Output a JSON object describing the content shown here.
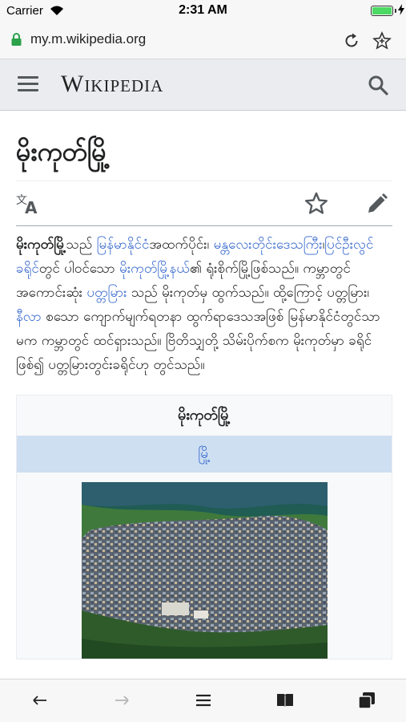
{
  "status_bar": {
    "carrier": "Carrier",
    "time": "2:31 AM",
    "battery_level": 1.0
  },
  "browser": {
    "url": "my.m.wikipedia.org"
  },
  "header": {
    "wordmark": "Wikipedia"
  },
  "page": {
    "title": "မိုးကုတ်မြို့",
    "article": {
      "lead_bold": "မိုးကုတ်မြို့",
      "t1": "သည် ",
      "link1": "မြန်မာနိုင်ငံ",
      "t2": "အထက်ပိုင်း၊ ",
      "link2": "မန္တလေးတိုင်းဒေသကြီး",
      "t3": "၊",
      "link3": "ပြင်ဦးလွင်ခရိုင်",
      "t4": "တွင် ပါဝင်သော ",
      "link4": "မိုးကုတ်မြို့နယ်",
      "t5": "၏ ရုံးစိုက်မြို့ဖြစ်သည်။ ကမ္ဘာတွင် အကောင်းဆုံး ",
      "link5": "ပတ္တမြား",
      "t6": " သည် မိုးကုတ်မှ ထွက်သည်။ ထို့ကြောင့် ပတ္တမြား၊ ",
      "link6": "နီလာ",
      "t7": " စသော ကျောက်မျက်ရတနာ ထွက်ရာဒေသအဖြစ် မြန်မာနိုင်ငံတွင်သာမက ကမ္ဘာတွင် ထင်ရှားသည်။ ဗြိတိသျှတို့ သိမ်းပိုက်စက မိုးကုတ်မှာ ခရိုင်ဖြစ်၍ ပတ္တမြားတွင်းခရိုင်ဟု တွင်သည်။"
    },
    "infobox": {
      "title": "မိုးကုတ်မြို့",
      "type": "မြို့"
    }
  },
  "colors": {
    "link": "#3366cc",
    "header_bg": "#eaecf0",
    "infobox_type_bg": "#cedff2"
  }
}
